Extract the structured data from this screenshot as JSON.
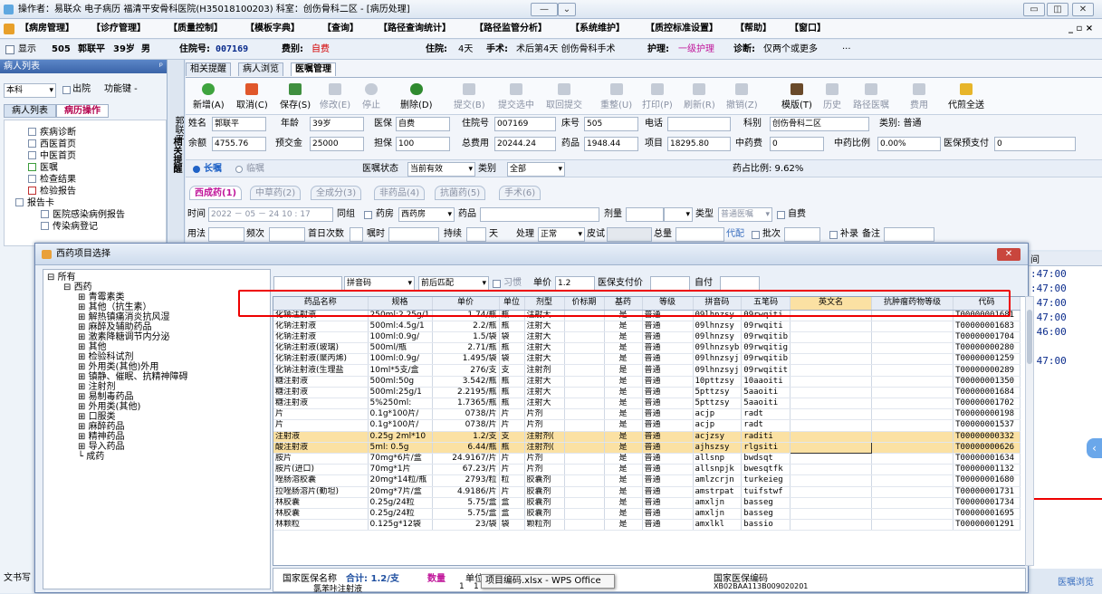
{
  "titlebar": {
    "text": "操作者：易联众 电子病历  福清平安骨科医院(H35018100203)  科室：创伤骨科二区 - [病历处理]",
    "ctrl": [
      "—",
      "⌄",
      "▭",
      "◫",
      "✕"
    ]
  },
  "menu": [
    "【病房管理】",
    "【诊疗管理】",
    "【质量控制】",
    "【模板字典】",
    "【查询】",
    "【路径查询统计】",
    "【路径监管分析】",
    "【系统维护】",
    "【质控标准设置】",
    "【帮助】",
    "【窗口】"
  ],
  "menu_right": "_ ▫ ×",
  "patient": {
    "show": "显示",
    "bed": "505",
    "name": "郭联平",
    "age": "39岁",
    "sex": "男",
    "inhosp_label": "住院号:",
    "inhosp": "007169",
    "fee_label": "费别:",
    "fee": "自费",
    "stay_label": "住院:",
    "stay": "4天",
    "op_label": "手术:",
    "op": "术后第4天 创伤骨科手术",
    "nurse_label": "护理:",
    "nurse": "一级护理",
    "diag_label": "诊断:",
    "diag": "仅两个或更多",
    "more": "···"
  },
  "left": {
    "header": "病人列表",
    "pin": "ᵖ",
    "scope": "本科",
    "out": "出院",
    "func": "功能键 -",
    "tabs": [
      "病人列表",
      "病历操作"
    ],
    "tree": [
      "疾病诊断",
      "西医首页",
      "中医首页",
      "医嘱",
      "检查结果",
      "检验报告",
      "报告卡",
      "医院感染病例报告",
      "传染病登记"
    ],
    "status": "文书写"
  },
  "mid_label": "相关提醒",
  "main": {
    "left_letters": "郭联平",
    "tabs": [
      "相关提醒",
      "病人浏览",
      "医嘱管理"
    ],
    "tools": [
      "新增(A)",
      "取消(C)",
      "保存(S)",
      "修改(E)",
      "停止",
      "删除(D)",
      "提交(B)",
      "提交选中",
      "取回提交",
      "重整(U)",
      "打印(P)",
      "刷新(R)",
      "撤销(Z)",
      "模版(T)",
      "历史",
      "路径医嘱",
      "费用",
      "代煎全送"
    ],
    "row1": {
      "name_l": "姓名",
      "name": "郭联平",
      "age_l": "年龄",
      "age": "39岁",
      "ins_l": "医保",
      "ins": "自费",
      "hos_l": "住院号",
      "hos": "007169",
      "bed_l": "床号",
      "bed": "505",
      "tel_l": "电话",
      "tel": "",
      "dept_l": "科别",
      "dept": "创伤骨科二区",
      "type_l": "类别: 普通"
    },
    "row2": {
      "bal_l": "余额",
      "bal": "4755.76",
      "pre_l": "预交金",
      "pre": "25000",
      "gua_l": "担保",
      "gua": "100",
      "tot_l": "总费用",
      "tot": "20244.24",
      "drug_l": "药品",
      "drug": "1948.44",
      "item_l": "项目",
      "item": "18295.80",
      "cm_l": "中药费",
      "cm": "0",
      "cmr_l": "中药比例",
      "cmr": "0.00%",
      "insp_l": "医保预支付",
      "insp": "0"
    },
    "order": {
      "long": "长嘱",
      "temp": "临嘱",
      "state_l": "医嘱状态",
      "state": "当前有效",
      "cat_l": "类别",
      "cat": "全部",
      "ratio": "药占比例: 9.62%"
    },
    "rxtabs": [
      "西成药(1)",
      "中草药(2)",
      "全成分(3)",
      "非药品(4)",
      "抗菌药(5)",
      "手术(6)"
    ],
    "f1": {
      "time_l": "时间",
      "time": "2022 － 05 － 24  10 : 17",
      "grp": "同组",
      "room": "药房",
      "room_v": "西药房",
      "drug_l": "药品",
      "dose_l": "剂量",
      "kind_l": "类型",
      "kind_v": "普通医嘱",
      "self": "自费"
    },
    "f2": {
      "use_l": "用法",
      "freq_l": "频次",
      "first_l": "首日次数",
      "note_l": "嘱时",
      "dur_l": "持续",
      "day": "天",
      "proc_l": "处理",
      "proc_v": "正常",
      "skin_l": "皮试",
      "total_l": "总量",
      "mix_l": "代配",
      "batch_l": "批次",
      "add_l": "补录",
      "rem_l": "备注"
    }
  },
  "dialog": {
    "title": "西药项目选择",
    "close": "✕",
    "tree": [
      "所有",
      "西药",
      "青霉素类",
      "其他（抗生素）",
      "解热镇痛消炎抗风湿",
      "麻醉及辅助药品",
      "激素降糖调节内分泌",
      "其他",
      "检验科试剂",
      "外用类(其他)外用",
      "镇静、催眠、抗精神障碍",
      "注射剂",
      "易制毒药品",
      "外用类(其他)",
      "口服类",
      "麻醉药品",
      "精神药品",
      "导入药品",
      "成药"
    ],
    "search": {
      "py": "拼音码",
      "match": "前后匹配",
      "habit": "习惯",
      "unit_l": "单价",
      "unit": "1.2",
      "ins_l": "医保支付价",
      "self_l": "自付"
    },
    "cols": [
      "药品名称",
      "规格",
      "单价",
      "单位",
      "剂型",
      "价标期",
      "基药",
      "等级",
      "拼音码",
      "五笔码",
      "英文名",
      "抗肿瘤药物等级",
      "代码"
    ],
    "rows": [
      [
        "化钠注射液",
        "250ml:2.25g/1",
        "1.74/瓶",
        "瓶",
        "注射大",
        "",
        "是",
        "普通",
        "09lhnzsy",
        "09rwqiti",
        "",
        "",
        "T00000001681"
      ],
      [
        "化钠注射液",
        "500ml:4.5g/1",
        "2.2/瓶",
        "瓶",
        "注射大",
        "",
        "是",
        "普通",
        "09lhnzsy",
        "09rwqiti",
        "",
        "",
        "T00000001683"
      ],
      [
        "化钠注射液",
        "100ml:0.9g/",
        "1.5/袋",
        "袋",
        "注射大",
        "",
        "是",
        "普通",
        "09lhnzsy",
        "09rwqitib",
        "",
        "",
        "T00000001704"
      ],
      [
        "化钠注射液(玻璃)",
        "500ml/瓶",
        "2.71/瓶",
        "瓶",
        "注射大",
        "",
        "是",
        "普通",
        "09lhnzsyb",
        "09rwqitig",
        "",
        "",
        "T00000000280"
      ],
      [
        "化钠注射液(聚丙烯)",
        "100ml:0.9g/",
        "1.495/袋",
        "袋",
        "注射大",
        "",
        "是",
        "普通",
        "09lhnzsyj",
        "09rwqitib",
        "",
        "",
        "T00000001259"
      ],
      [
        "化钠注射液(生理盐",
        "10ml*5支/盒",
        "276/支",
        "支",
        "注射剂",
        "",
        "是",
        "普通",
        "09lhnzsyj",
        "09rwqitit",
        "",
        "",
        "T00000000289"
      ],
      [
        "糖注射液",
        "500ml:50g",
        "3.542/瓶",
        "瓶",
        "注射大",
        "",
        "是",
        "普通",
        "10pttzsy",
        "10aaoiti",
        "",
        "",
        "T00000001350"
      ],
      [
        "糖注射液",
        "500ml:25g/1",
        "2.2195/瓶",
        "瓶",
        "注射大",
        "",
        "是",
        "普通",
        "5pttzsy",
        "5aaoiti",
        "",
        "",
        "T00000001684"
      ],
      [
        "糖注射液",
        "5%250ml:",
        "1.7365/瓶",
        "瓶",
        "注射大",
        "",
        "是",
        "普通",
        "5pttzsy",
        "5aaoiti",
        "",
        "",
        "T00000001702"
      ],
      [
        "片",
        "0.1g*100片/",
        "0738/片",
        "片",
        "片剂",
        "",
        "是",
        "普通",
        "acjp",
        "radt",
        "",
        "",
        "T00000000198"
      ],
      [
        "片",
        "0.1g*100片/",
        "0738/片",
        "片",
        "片剂",
        "",
        "是",
        "普通",
        "acjp",
        "radt",
        "",
        "",
        "T00000001537"
      ],
      [
        "注射液",
        "0.25g 2ml*10",
        "1.2/支",
        "支",
        "注射剂(",
        "",
        "是",
        "普通",
        "acjzsy",
        "raditi",
        "",
        "",
        "T00000000332"
      ],
      [
        "酸注射液",
        "5ml: 0.5g",
        "6.44/瓶",
        "瓶",
        "注射剂(",
        "",
        "是",
        "普通",
        "ajhszsy",
        "rlgsiti",
        "",
        "",
        "T00000000626"
      ],
      [
        "胺片",
        "70mg*6片/盒",
        "24.9167/片",
        "片",
        "片剂",
        "",
        "是",
        "普通",
        "allsnp",
        "bwdsqt",
        "",
        "",
        "T00000001634"
      ],
      [
        "胺片(进口)",
        "70mg*1片",
        "67.23/片",
        "片",
        "片剂",
        "",
        "是",
        "普通",
        "allsnpjk",
        "bwesqtfk",
        "",
        "",
        "T00000001132"
      ],
      [
        "唑肠溶胶囊",
        "20mg*14粒/瓶",
        "2793/粒",
        "粒",
        "胶囊剂",
        "",
        "是",
        "普通",
        "amlzcrjn",
        "turkeieg",
        "",
        "",
        "T00000001680"
      ],
      [
        "拉唑肠溶片(勤坦)",
        "20mg*7片/盒",
        "4.9186/片",
        "片",
        "胶囊剂",
        "",
        "是",
        "普通",
        "amstrpat",
        "tuifstwf",
        "",
        "",
        "T00000001731"
      ],
      [
        "林胶囊",
        "0.25g/24粒",
        "5.75/盒",
        "盒",
        "胶囊剂",
        "",
        "是",
        "普通",
        "amxljn",
        "basseg",
        "",
        "",
        "T00000001734"
      ],
      [
        "林胶囊",
        "0.25g/24粒",
        "5.75/盒",
        "盒",
        "胶囊剂",
        "",
        "是",
        "普通",
        "amxljn",
        "basseg",
        "",
        "",
        "T00000001695"
      ],
      [
        "林颗粒",
        "0.125g*12袋",
        "23/袋",
        "袋",
        "颗粒剂",
        "",
        "是",
        "普通",
        "amxlkl",
        "bassio",
        "",
        "",
        "T00000001291"
      ]
    ],
    "bottom": {
      "a": "国家医保名称",
      "sum": "合计: 1.2/支",
      "qty": "数量",
      "unit": "单位",
      "b": "国家医保编码",
      "row1": "氯苯咔注射液",
      "row1b": "1",
      "row1c": "1",
      "code": "XB02BAA113B009020201"
    },
    "tooltip": "项目编码.xlsx - WPS Office"
  },
  "right": {
    "h": "间",
    "times": [
      ":47:00",
      ":47:00",
      ":47:00",
      ":47:00",
      ":46:00",
      ":47:00"
    ],
    "status": "医嘱浏览"
  }
}
